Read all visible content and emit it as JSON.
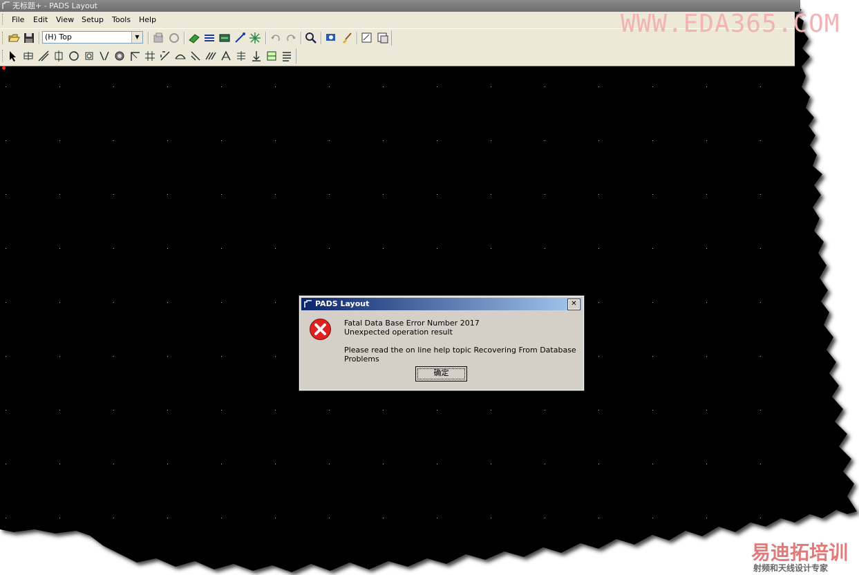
{
  "window": {
    "title": "无标题+ - PADS Layout"
  },
  "menu": [
    "File",
    "Edit",
    "View",
    "Setup",
    "Tools",
    "Help"
  ],
  "toolbar": {
    "layer_select_value": "(H) Top"
  },
  "watermark": "WWW.EDA365.COM",
  "logo": {
    "main": "易迪拓培训",
    "sub": "射频和天线设计专家"
  },
  "dialog": {
    "title": "PADS Layout",
    "line1": "Fatal Data Base Error Number 2017",
    "line2": "Unexpected operation result",
    "line3": "Please read the on line help topic Recovering From Database Problems",
    "ok_label": "确定",
    "close_glyph": "✕"
  },
  "colors": {
    "canvas": "#000000",
    "dialog_bg": "#d4d0c8",
    "title_active": "#0a246a",
    "watermark": "#f1b3b3"
  }
}
